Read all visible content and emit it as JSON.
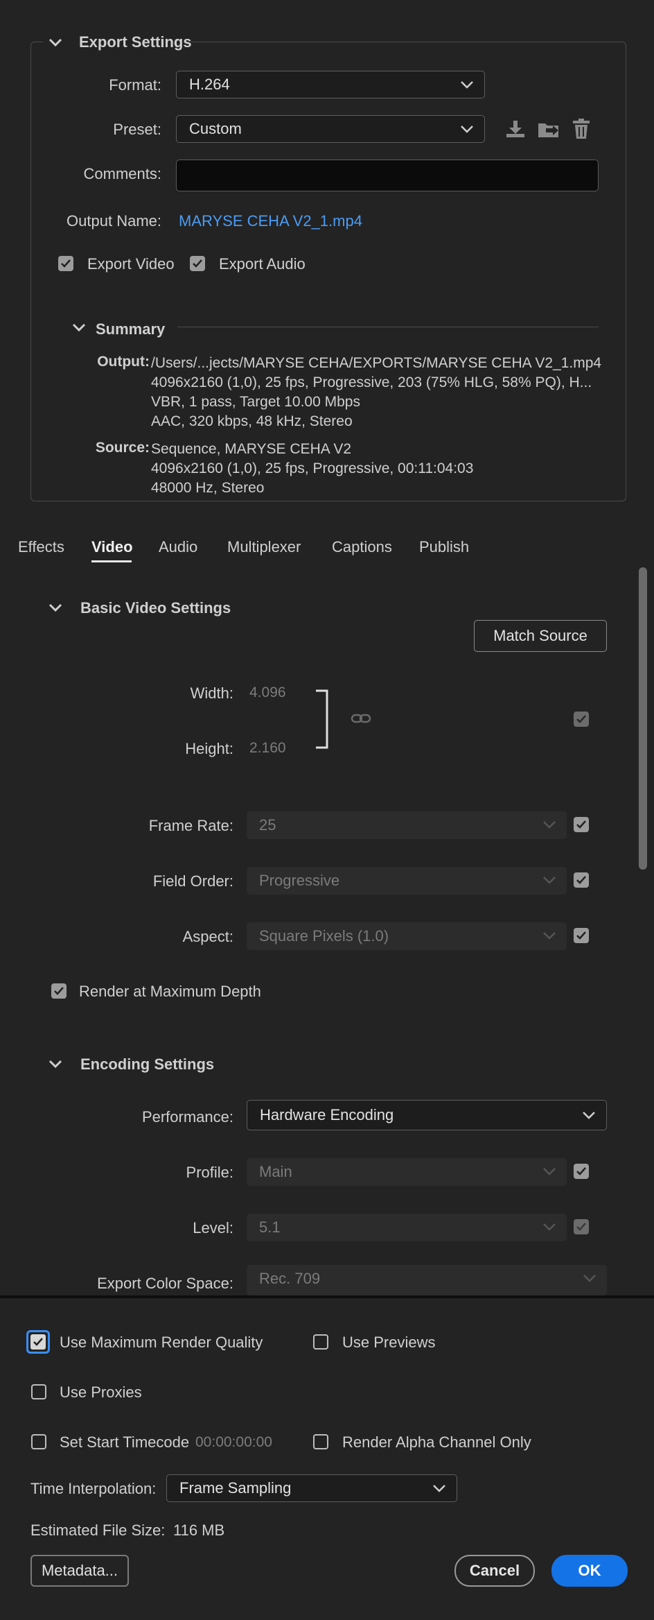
{
  "export_settings": {
    "title": "Export Settings",
    "format_label": "Format:",
    "format_value": "H.264",
    "preset_label": "Preset:",
    "preset_value": "Custom",
    "comments_label": "Comments:",
    "comments_value": "",
    "output_name_label": "Output Name:",
    "output_name_value": "MARYSE CEHA V2_1.mp4",
    "export_video_label": "Export Video",
    "export_video_checked": true,
    "export_audio_label": "Export Audio",
    "export_audio_checked": true
  },
  "summary": {
    "title": "Summary",
    "output_label": "Output:",
    "output_lines": [
      "/Users/...jects/MARYSE CEHA/EXPORTS/MARYSE CEHA V2_1.mp4",
      "4096x2160 (1,0), 25 fps, Progressive, 203 (75% HLG, 58% PQ), H...",
      "VBR, 1 pass, Target 10.00 Mbps",
      "AAC, 320 kbps, 48 kHz, Stereo"
    ],
    "source_label": "Source:",
    "source_lines": [
      "Sequence, MARYSE CEHA V2",
      "4096x2160 (1,0), 25 fps, Progressive, 00:11:04:03",
      "48000 Hz, Stereo"
    ]
  },
  "tabs": [
    "Effects",
    "Video",
    "Audio",
    "Multiplexer",
    "Captions",
    "Publish"
  ],
  "active_tab": "Video",
  "basic_video": {
    "title": "Basic Video Settings",
    "match_source": "Match Source",
    "width_label": "Width:",
    "width_value": "4.096",
    "height_label": "Height:",
    "height_value": "2.160",
    "frame_rate_label": "Frame Rate:",
    "frame_rate_value": "25",
    "field_order_label": "Field Order:",
    "field_order_value": "Progressive",
    "aspect_label": "Aspect:",
    "aspect_value": "Square Pixels (1.0)",
    "render_max_depth_label": "Render at Maximum Depth"
  },
  "encoding": {
    "title": "Encoding Settings",
    "performance_label": "Performance:",
    "performance_value": "Hardware Encoding",
    "profile_label": "Profile:",
    "profile_value": "Main",
    "level_label": "Level:",
    "level_value": "5.1",
    "color_space_label": "Export Color Space:",
    "color_space_value": "Rec. 709"
  },
  "bottom": {
    "max_render_quality_label": "Use Maximum Render Quality",
    "max_render_quality_checked": true,
    "use_previews_label": "Use Previews",
    "use_proxies_label": "Use Proxies",
    "set_start_timecode_label": "Set Start Timecode",
    "start_timecode_value": "00:00:00:00",
    "render_alpha_label": "Render Alpha Channel Only",
    "time_interp_label": "Time Interpolation:",
    "time_interp_value": "Frame Sampling",
    "est_size_label": "Estimated File Size:",
    "est_size_value": "116 MB",
    "metadata_button": "Metadata...",
    "cancel_button": "Cancel",
    "ok_button": "OK"
  },
  "colors": {
    "background": "#232323",
    "accent_blue": "#1473e6",
    "link_blue": "#4b9cf5",
    "checkbox_focus": "#3a8ef7"
  }
}
